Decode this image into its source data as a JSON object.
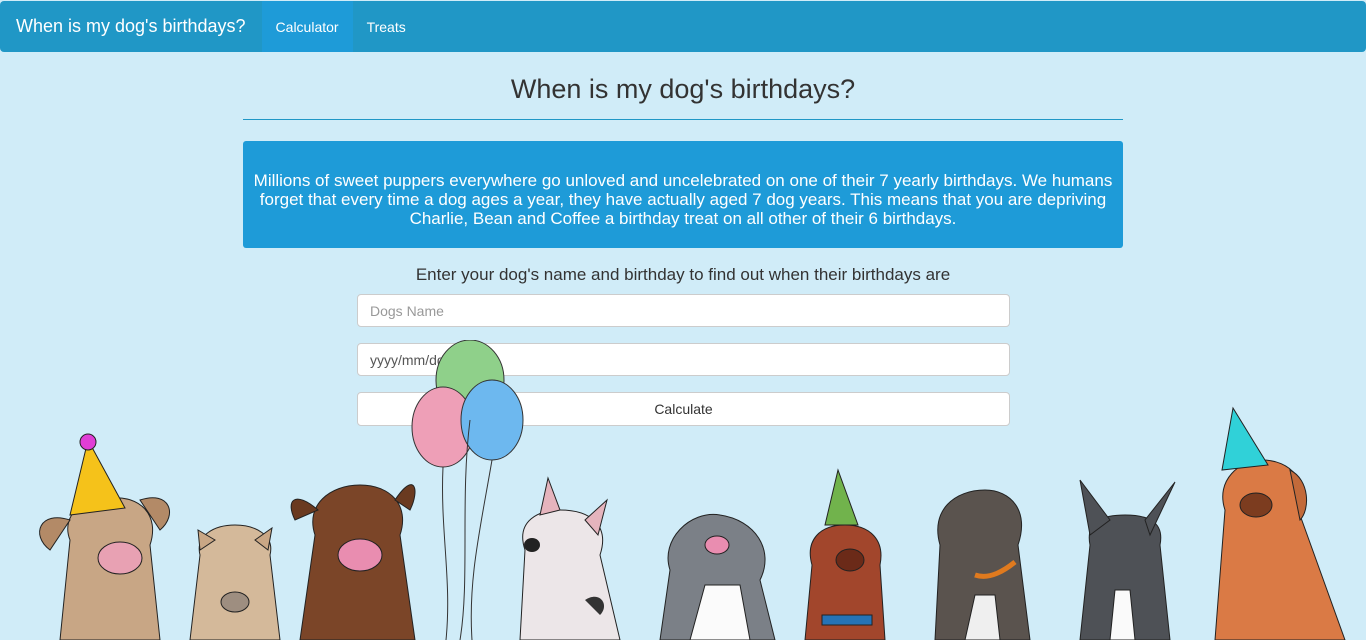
{
  "navbar": {
    "brand": "When is my dog's birthdays?",
    "items": [
      {
        "label": "Calculator",
        "active": true
      },
      {
        "label": "Treats",
        "active": false
      }
    ]
  },
  "main": {
    "title": "When is my dog's birthdays?",
    "alert": "Millions of sweet puppers everywhere go unloved and uncelebrated on one of their 7 yearly birthdays. We humans forget that every time a dog ages a year, they have actually aged 7 dog years. This means that you are depriving Charlie, Bean and Coffee a birthday treat on all other of their 6 birthdays.",
    "prompt": "Enter your dog's name and birthday to find out when their birthdays are"
  },
  "form": {
    "name_placeholder": "Dogs Name",
    "date_placeholder": "yyyy/mm/dd",
    "calculate_label": "Calculate"
  },
  "colors": {
    "navbar": "#2097c6",
    "active_nav": "#1e9bd8",
    "background": "#d0ecf8",
    "alert": "#1e9bd8"
  }
}
